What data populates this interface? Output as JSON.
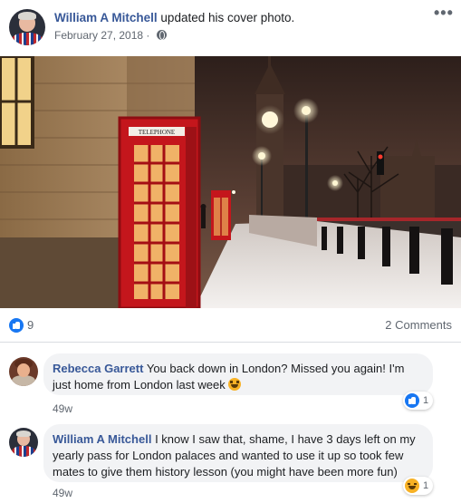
{
  "post": {
    "author": "William A Mitchell",
    "action": "updated his cover photo.",
    "date": "February 27, 2018",
    "more_icon": "more-horizontal-icon",
    "privacy_icon": "globe-icon"
  },
  "photo": {
    "telephone_sign": "TELEPHONE",
    "colors": {
      "booth_red": "#c4161c",
      "sky": "#3e2a24",
      "snow": "#eeeeee"
    }
  },
  "reactions": {
    "like_count": "9",
    "comments_label": "2 Comments",
    "like_color": "#1877f2"
  },
  "comments": [
    {
      "author": "Rebecca Garrett",
      "text_line1": "You back down in London? Missed you again! I'm",
      "text_line2": "just home from London last week",
      "time": "49w",
      "reaction_count": "1",
      "reaction_icon": "like-icon"
    },
    {
      "author": "William A Mitchell",
      "text_line1": "I know I saw that, shame, I have 3 days left on my",
      "text_line2": "yearly pass for London palaces and wanted to use it up so took few",
      "text_line3": "mates to give them history lesson (you might have been more fun)",
      "time": "49w",
      "reaction_count": "1",
      "reaction_icon": "haha-icon"
    }
  ]
}
